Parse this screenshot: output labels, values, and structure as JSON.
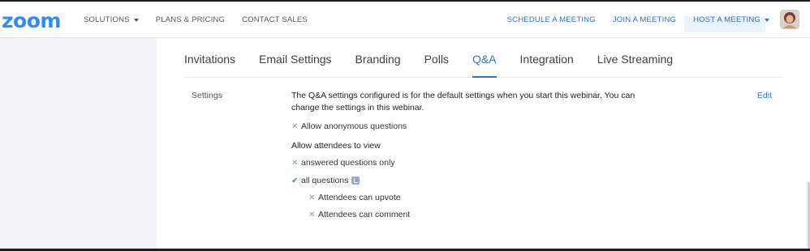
{
  "brand": {
    "logo_text": "zoom",
    "accent_color": "#2d8cff",
    "link_color": "#2d70d8"
  },
  "topnav": {
    "left_items": [
      {
        "label": "SOLUTIONS",
        "has_caret": true
      },
      {
        "label": "PLANS & PRICING",
        "has_caret": false
      },
      {
        "label": "CONTACT SALES",
        "has_caret": false
      }
    ],
    "right_items": [
      {
        "label": "SCHEDULE A MEETING",
        "has_caret": false
      },
      {
        "label": "JOIN A MEETING",
        "has_caret": false
      },
      {
        "label": "HOST A MEETING",
        "has_caret": true
      }
    ]
  },
  "tabs": [
    {
      "label": "Invitations",
      "active": false
    },
    {
      "label": "Email Settings",
      "active": false
    },
    {
      "label": "Branding",
      "active": false
    },
    {
      "label": "Polls",
      "active": false
    },
    {
      "label": "Q&A",
      "active": true
    },
    {
      "label": "Integration",
      "active": false
    },
    {
      "label": "Live Streaming",
      "active": false
    }
  ],
  "settings": {
    "section_label": "Settings",
    "edit_label": "Edit",
    "description": "The Q&A settings configured is for the default settings when you start this webinar. You can change the settings in this webinar.",
    "allow_anonymous": {
      "label": "Allow anonymous questions",
      "enabled": false
    },
    "attendees_view_heading": "Allow attendees to view",
    "answered_only": {
      "label": "answered questions only",
      "enabled": false
    },
    "all_questions": {
      "label": "all questions",
      "enabled": true
    },
    "can_upvote": {
      "label": "Attendees can upvote",
      "enabled": false
    },
    "can_comment": {
      "label": "Attendees can comment",
      "enabled": false
    }
  }
}
